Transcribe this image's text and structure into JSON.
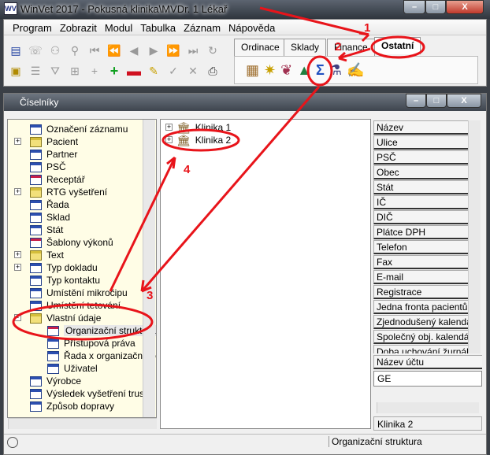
{
  "window": {
    "title": "WinVet 2017  - Pokusná klinika\\MVDr. 1 Lékař",
    "app_icon": "WV",
    "minimize": "–",
    "maximize": "□",
    "close": "X"
  },
  "menu": [
    "Program",
    "Zobrazit",
    "Modul",
    "Tabulka",
    "Záznam",
    "Nápověda"
  ],
  "toolbar": {
    "row1_icons": [
      "print-icon",
      "phone-icon",
      "group-icon",
      "pin-icon",
      "first-icon",
      "prev-page-icon",
      "prev-icon",
      "next-icon",
      "next-page-icon",
      "last-icon",
      "refresh-icon"
    ],
    "row2_icons": [
      "export-icon",
      "list-icon",
      "filter-icon",
      "tree-add-icon",
      "tree-add-small-icon",
      "add-icon",
      "remove-icon",
      "edit-icon",
      "confirm-icon",
      "cancel-icon",
      "printer-icon"
    ],
    "tabs": [
      "Ordinace",
      "Sklady",
      "Finance",
      "Ostatní"
    ],
    "active_tab": "Ostatní",
    "module_icons": [
      "boxes-icon",
      "magic-wand-icon",
      "animals-icon",
      "codebooks-icon",
      "sum-icon",
      "microscope-icon",
      "notes-icon"
    ]
  },
  "child_window": {
    "title": "Číselníky",
    "minimize": "–",
    "maximize": "□",
    "close": "X"
  },
  "tree": [
    {
      "label": "Označení záznamu",
      "icon": "table",
      "level": 0
    },
    {
      "label": "Pacient",
      "icon": "folder",
      "level": 0,
      "expand": "+"
    },
    {
      "label": "Partner",
      "icon": "table",
      "level": 0
    },
    {
      "label": "PSČ",
      "icon": "table",
      "level": 0
    },
    {
      "label": "Receptář",
      "icon": "table-red",
      "level": 0
    },
    {
      "label": "RTG vyšetření",
      "icon": "folder",
      "level": 0,
      "expand": "+"
    },
    {
      "label": "Řada",
      "icon": "table",
      "level": 0
    },
    {
      "label": "Sklad",
      "icon": "table",
      "level": 0
    },
    {
      "label": "Stát",
      "icon": "table",
      "level": 0
    },
    {
      "label": "Šablony výkonů",
      "icon": "table-red",
      "level": 0
    },
    {
      "label": "Text",
      "icon": "folder",
      "level": 0,
      "expand": "+"
    },
    {
      "label": "Typ dokladu",
      "icon": "table",
      "level": 0,
      "expand": "+"
    },
    {
      "label": "Typ kontaktu",
      "icon": "table",
      "level": 0
    },
    {
      "label": "Umístění mikročipu",
      "icon": "table",
      "level": 0
    },
    {
      "label": "Umístění tetování",
      "icon": "table",
      "level": 0
    },
    {
      "label": "Vlastní údaje",
      "icon": "folder",
      "level": 0,
      "expand": "-"
    },
    {
      "label": "Organizační struktura",
      "icon": "table-red",
      "level": 1,
      "selected": true
    },
    {
      "label": "Přístupová práva",
      "icon": "table",
      "level": 1
    },
    {
      "label": "Řada x organizační jec",
      "icon": "table",
      "level": 1
    },
    {
      "label": "Uživatel",
      "icon": "table",
      "level": 1
    },
    {
      "label": "Výrobce",
      "icon": "table",
      "level": 0
    },
    {
      "label": "Výsledek vyšetření trusu",
      "icon": "table",
      "level": 0
    },
    {
      "label": "Způsob dopravy",
      "icon": "table",
      "level": 0
    }
  ],
  "org_tree": [
    {
      "label": "Klinika 1",
      "expand": "+"
    },
    {
      "label": "Klinika 2",
      "expand": "+"
    }
  ],
  "fields": [
    "Název",
    "Ulice",
    "PSČ",
    "Obec",
    "Stát",
    "IČ",
    "DIČ",
    "Plátce DPH",
    "Telefon",
    "Fax",
    "E-mail",
    "Registrace",
    "Jedna fronta pacientů",
    "Zjednodušený kalendář",
    "Společný obj. kalendář",
    "Doba uchování žurnálu"
  ],
  "account": {
    "label": "Název účtu",
    "value": "GE"
  },
  "selected_name": "Klinika 2",
  "status": {
    "text": "Organizační struktura"
  },
  "annotations": [
    "1",
    "2",
    "3",
    "4"
  ],
  "colors": {
    "annotation": "#e8141a",
    "tree_bg": "#fffde6",
    "table_icon": "#2c4fb0"
  }
}
